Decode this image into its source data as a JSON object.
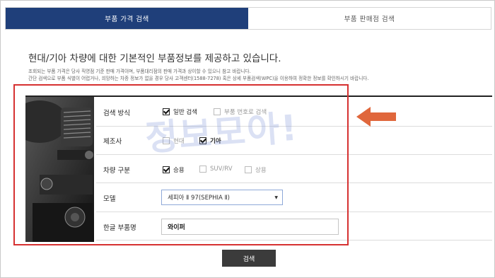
{
  "tabs": [
    {
      "label": "부품 가격 검색",
      "active": true
    },
    {
      "label": "부품 판매점 검색",
      "active": false
    }
  ],
  "intro": {
    "title": "현대/기아 차량에 대한 기본적인 부품정보를 제공하고 있습니다.",
    "line1": "조회되는 부품 가격은 당사 직영점 기준 판매 가격이며, 부품대리점의 판매 가격과 상이할 수 있으니 참고 바랍니다.",
    "line2": "간단 검색으로 부품 식별이 어렵거나, 희망하는 차종 정보가 없을 경우 당사 고객센터(1588-7278) 혹은 상세 부품검색(WPC)을 이용하여 정확한 정보를 확인하시기 바랍니다."
  },
  "form": {
    "search_method": {
      "label": "검색 방식",
      "options": [
        {
          "label": "일반 검색",
          "checked": true
        },
        {
          "label": "부품 번호로 검색",
          "checked": false
        }
      ]
    },
    "maker": {
      "label": "제조사",
      "options": [
        {
          "label": "현대",
          "checked": false
        },
        {
          "label": "기아",
          "checked": true
        }
      ]
    },
    "vehicle_type": {
      "label": "차량 구분",
      "options": [
        {
          "label": "승용",
          "checked": true
        },
        {
          "label": "SUV/RV",
          "checked": false
        },
        {
          "label": "상용",
          "checked": false
        }
      ]
    },
    "model": {
      "label": "모델",
      "selected": "세피아 Ⅱ 97(SEPHIA Ⅱ)"
    },
    "part_name": {
      "label": "한글 부품명",
      "value": "와이퍼"
    },
    "search_button": "검색"
  },
  "watermark": "정보모아!",
  "colors": {
    "tab_active": "#1f3f7a",
    "highlight_red": "#d63131",
    "arrow_orange": "#e0673c",
    "button": "#3b3b3b"
  }
}
